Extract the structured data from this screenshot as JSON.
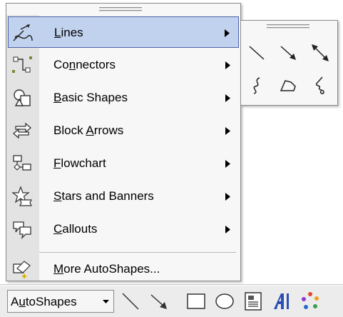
{
  "menu": {
    "items": [
      {
        "label_pre": "",
        "label_u": "L",
        "label_post": "ines",
        "icon": "lines-icon",
        "has_submenu": true,
        "hover": true
      },
      {
        "label_pre": "Co",
        "label_u": "n",
        "label_post": "nectors",
        "icon": "connectors-icon",
        "has_submenu": true
      },
      {
        "label_pre": "",
        "label_u": "B",
        "label_post": "asic Shapes",
        "icon": "basic-shapes-icon",
        "has_submenu": true
      },
      {
        "label_pre": "Block ",
        "label_u": "A",
        "label_post": "rrows",
        "icon": "block-arrows-icon",
        "has_submenu": true
      },
      {
        "label_pre": "",
        "label_u": "F",
        "label_post": "lowchart",
        "icon": "flowchart-icon",
        "has_submenu": true
      },
      {
        "label_pre": "",
        "label_u": "S",
        "label_post": "tars and Banners",
        "icon": "stars-banners-icon",
        "has_submenu": true
      },
      {
        "label_pre": "",
        "label_u": "C",
        "label_post": "allouts",
        "icon": "callouts-icon",
        "has_submenu": true
      },
      {
        "label_pre": "",
        "label_u": "M",
        "label_post": "ore AutoShapes...",
        "icon": "more-autoshapes-icon",
        "has_submenu": false
      }
    ]
  },
  "submenu": {
    "tools": [
      "line-icon",
      "arrow-icon",
      "double-arrow-icon",
      "curve-icon",
      "freeform-icon",
      "scribble-icon"
    ]
  },
  "toolbar": {
    "autoshapes_pre": "A",
    "autoshapes_u": "u",
    "autoshapes_post": "toShapes",
    "tools": [
      "line-icon",
      "arrow-icon",
      "rectangle-icon",
      "oval-icon",
      "text-box-icon",
      "wordart-icon",
      "diagram-icon"
    ]
  },
  "colors": {
    "hover_fill": "#c1d2ee",
    "hover_border": "#4b63a7",
    "icon_strip": "#e3e3e3",
    "menu_bg": "#f7f7f7",
    "wordart_blue": "#2b4fb5"
  }
}
